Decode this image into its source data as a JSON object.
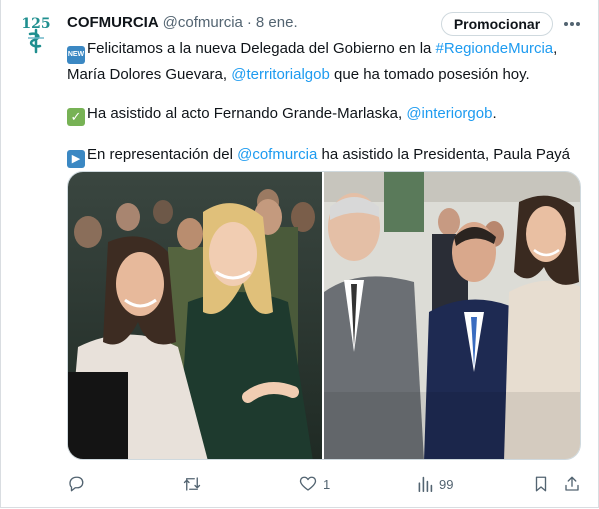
{
  "tweet": {
    "author_name": "COFMURCIA",
    "author_handle": "@cofmurcia",
    "separator": "·",
    "date": "8 ene.",
    "promote_label": "Promocionar",
    "line1_before": "Felicitamos a la nueva Delegada del Gobierno en la ",
    "line1_hashtag": "#RegiondeMurcia",
    "line1_after": ",",
    "line2_before": "María Dolores Guevara, ",
    "line2_mention": "@territorialgob",
    "line2_after": " que ha tomado posesión hoy.",
    "line3_before": "Ha asistido al acto Fernando Grande-Marlaska, ",
    "line3_mention": "@interiorgob",
    "line3_after": ".",
    "line4_before": "En representación del ",
    "line4_mention": "@cofmurcia",
    "line4_after": " ha asistido la Presidenta, Paula Payá",
    "new_emoji_text": "NEW",
    "check_emoji_text": "✓",
    "play_emoji_text": "▶"
  },
  "actions": {
    "reply_count": "",
    "retweet_count": "",
    "like_count": "1",
    "views_count": "99"
  },
  "icons": {
    "avatar": "cof-logo-icon",
    "more": "more-dots-icon",
    "reply": "reply-icon",
    "retweet": "retweet-icon",
    "like": "heart-icon",
    "views": "views-chart-icon",
    "bookmark": "bookmark-icon",
    "share": "share-icon"
  },
  "colors": {
    "link": "#1d9bf0",
    "text": "#0f1419",
    "muted": "#536471",
    "border": "#cfd9de"
  }
}
